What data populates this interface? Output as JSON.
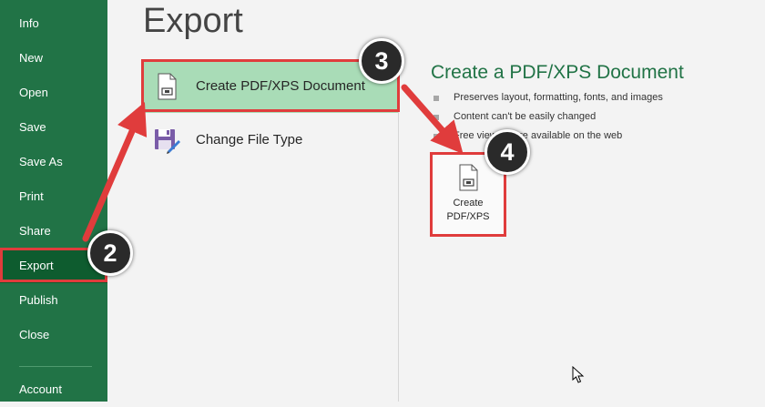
{
  "sidebar": {
    "items": [
      {
        "label": "Info"
      },
      {
        "label": "New"
      },
      {
        "label": "Open"
      },
      {
        "label": "Save"
      },
      {
        "label": "Save As"
      },
      {
        "label": "Print"
      },
      {
        "label": "Share"
      },
      {
        "label": "Export",
        "active": true
      },
      {
        "label": "Publish"
      },
      {
        "label": "Close"
      },
      {
        "label": "Account"
      }
    ]
  },
  "page": {
    "title": "Export"
  },
  "export_options": [
    {
      "label": "Create PDF/XPS Document",
      "icon": "pdf-document-icon",
      "selected": true
    },
    {
      "label": "Change File Type",
      "icon": "change-file-type-icon"
    }
  ],
  "detail": {
    "title": "Create a PDF/XPS Document",
    "bullets": [
      "Preserves layout, formatting, fonts, and images",
      "Content can't be easily changed",
      "Free viewers are available on the web"
    ],
    "button": {
      "line1": "Create",
      "line2": "PDF/XPS",
      "icon": "pdf-document-icon"
    }
  },
  "annotations": {
    "steps": [
      "2",
      "3",
      "4"
    ],
    "color": "#e03c3c"
  },
  "colors": {
    "accent": "#217346",
    "selected_bg": "#a9dcb7",
    "sidebar_active": "#0e5c2f"
  }
}
